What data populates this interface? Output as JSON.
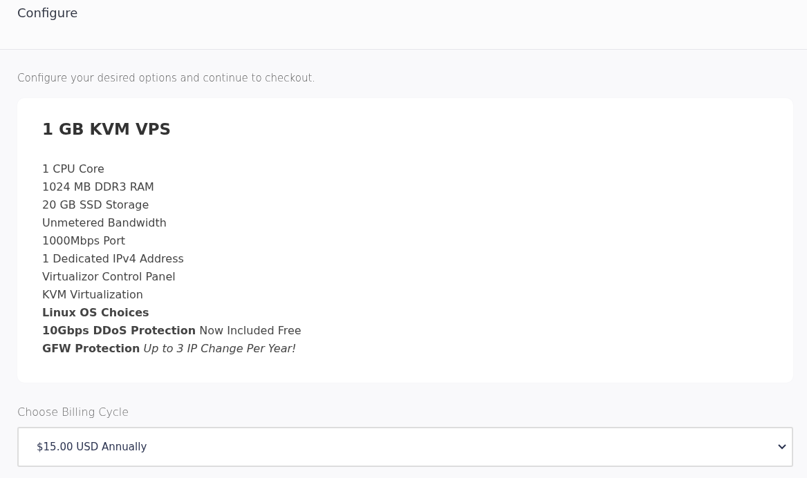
{
  "header": {
    "title": "Configure"
  },
  "intro": "Configure your desired options and continue to checkout.",
  "product": {
    "name": "1 GB KVM VPS",
    "features": [
      {
        "text": "1 CPU Core",
        "bold": false
      },
      {
        "text": "1024 MB DDR3 RAM",
        "bold": false
      },
      {
        "text": "20 GB SSD Storage",
        "bold": false
      },
      {
        "text": "Unmetered Bandwidth",
        "bold": false
      },
      {
        "text": "1000Mbps Port",
        "bold": false
      },
      {
        "text": "1 Dedicated IPv4 Address",
        "bold": false
      },
      {
        "text": "Virtualizor Control Panel",
        "bold": false
      },
      {
        "text": "KVM Virtualization",
        "bold": false
      },
      {
        "text": "Linux OS Choices",
        "bold": true
      },
      {
        "text": "**10Gbps DDoS Protection** Now Included Free",
        "bold": false
      },
      {
        "text": "**GFW Protection** *Up to 3 IP Change Per Year!*",
        "bold": false
      }
    ]
  },
  "billing": {
    "label": "Choose Billing Cycle",
    "value": "$15.00 USD Annually"
  }
}
